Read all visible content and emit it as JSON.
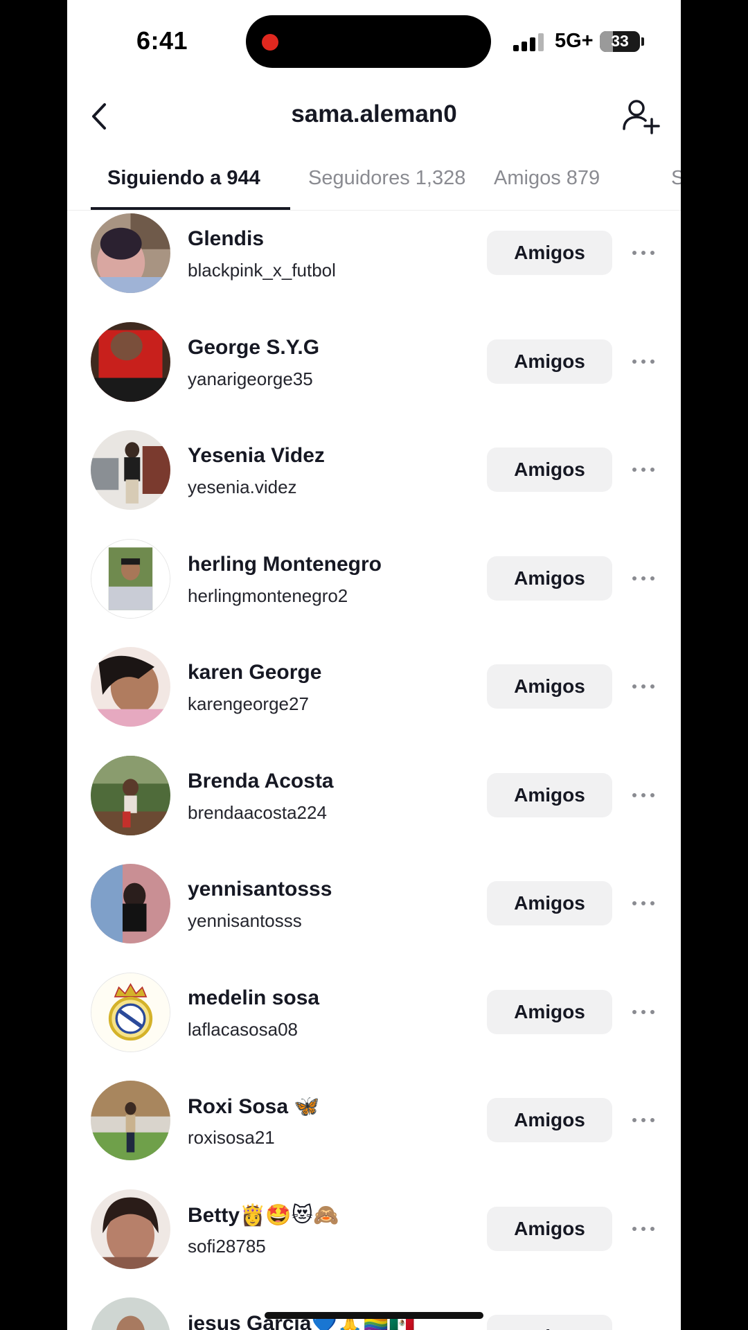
{
  "status_bar": {
    "time": "6:41",
    "network": "5G+",
    "battery": "33",
    "battery_level_percent": 33,
    "signal_bars": 3,
    "signal_bars_max": 4,
    "recording_indicator_color": "#e0281f"
  },
  "header": {
    "title": "sama.aleman0",
    "back_icon": "chevron-left-icon",
    "add_icon": "add-user-icon"
  },
  "tabs": [
    {
      "label": "Siguiendo a 944",
      "active": true
    },
    {
      "label": "Seguidores 1,328",
      "active": false
    },
    {
      "label": "Amigos 879",
      "active": false
    },
    {
      "label": "S",
      "active": false
    }
  ],
  "users": [
    {
      "name": "Glendis",
      "handle": "blackpink_x_futbol",
      "button": "Amigos"
    },
    {
      "name": "George S.Y.G",
      "handle": "yanarigeorge35",
      "button": "Amigos"
    },
    {
      "name": "Yesenia Videz",
      "handle": "yesenia.videz",
      "button": "Amigos"
    },
    {
      "name": "herling Montenegro",
      "handle": "herlingmontenegro2",
      "button": "Amigos"
    },
    {
      "name": "karen George",
      "handle": "karengeorge27",
      "button": "Amigos"
    },
    {
      "name": "Brenda Acosta",
      "handle": "brendaacosta224",
      "button": "Amigos"
    },
    {
      "name": "yennisantosss",
      "handle": "yennisantosss",
      "button": "Amigos"
    },
    {
      "name": "medelin sosa",
      "handle": "laflacasosa08",
      "button": "Amigos"
    },
    {
      "name": "Roxi Sosa 🦋",
      "handle": "roxisosa21",
      "button": "Amigos"
    },
    {
      "name": "Betty👸🤩😻🙈",
      "handle": "sofi28785",
      "button": "Amigos"
    },
    {
      "name": "jesus Garcia💙🙏🏳️‍🌈🇲🇽",
      "handle": "",
      "button": "Amigos"
    }
  ],
  "colors": {
    "text_primary": "#161823",
    "text_secondary": "#8a8b91",
    "button_bg": "#f1f1f2",
    "background": "#ffffff"
  }
}
